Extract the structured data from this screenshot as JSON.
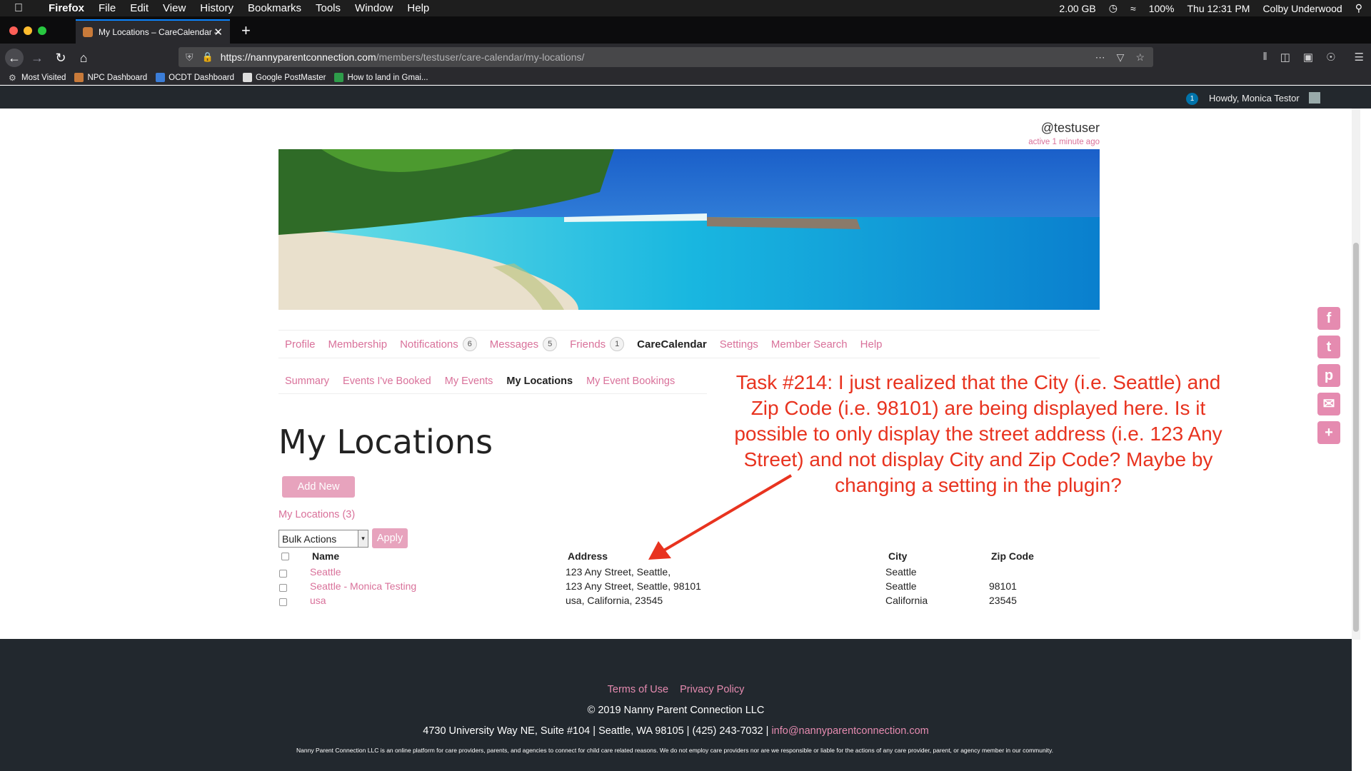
{
  "menubar": {
    "app": "Firefox",
    "items": [
      "File",
      "Edit",
      "View",
      "History",
      "Bookmarks",
      "Tools",
      "Window",
      "Help"
    ],
    "memory": "2.00 GB",
    "battery": "100%",
    "clock": "Thu 12:31 PM",
    "user": "Colby Underwood"
  },
  "browser": {
    "tab_title": "My Locations – CareCalendar –",
    "url_domain": "https://nannyparentconnection.com",
    "url_path": "/members/testuser/care-calendar/my-locations/",
    "bookmarks": [
      "Most Visited",
      "NPC Dashboard",
      "OCDT Dashboard",
      "Google PostMaster",
      "How to land in Gmai..."
    ]
  },
  "adminbar": {
    "notification_count": "1",
    "howdy": "Howdy, Monica Testor"
  },
  "profile": {
    "username": "@testuser",
    "activity": "active 1 minute ago"
  },
  "main_nav": [
    {
      "label": "Profile",
      "badge": ""
    },
    {
      "label": "Membership",
      "badge": ""
    },
    {
      "label": "Notifications",
      "badge": "6"
    },
    {
      "label": "Messages",
      "badge": "5"
    },
    {
      "label": "Friends",
      "badge": "1"
    },
    {
      "label": "CareCalendar",
      "badge": ""
    },
    {
      "label": "Settings",
      "badge": ""
    },
    {
      "label": "Member Search",
      "badge": ""
    },
    {
      "label": "Help",
      "badge": ""
    }
  ],
  "sub_nav": [
    "Summary",
    "Events I've Booked",
    "My Events",
    "My Locations",
    "My Event Bookings"
  ],
  "page": {
    "title": "My Locations",
    "add_new": "Add New",
    "count_label": "My Locations (3)",
    "bulk_actions": "Bulk Actions",
    "apply": "Apply"
  },
  "table": {
    "headers": {
      "name": "Name",
      "address": "Address",
      "city": "City",
      "zip": "Zip Code"
    },
    "rows": [
      {
        "name": "Seattle",
        "address": "123 Any Street, Seattle,",
        "city": "Seattle",
        "zip": ""
      },
      {
        "name": "Seattle - Monica Testing",
        "address": "123 Any Street, Seattle, 98101",
        "city": "Seattle",
        "zip": "98101"
      },
      {
        "name": "usa",
        "address": "usa, California, 23545",
        "city": "California",
        "zip": "23545"
      }
    ]
  },
  "annotation": {
    "lines": [
      "Task #214: I just realized that the City (i.e. Seattle) and",
      "Zip Code (i.e. 98101) are being displayed here. Is it",
      "possible to only display the street address (i.e. 123 Any",
      "Street) and not display City and Zip Code? Maybe by",
      "changing a setting in the plugin?"
    ],
    "color": "#e8331f"
  },
  "share_icons": [
    "facebook-icon",
    "twitter-icon",
    "pinterest-icon",
    "email-icon",
    "plus-icon"
  ],
  "footer": {
    "terms": "Terms of Use",
    "privacy": "Privacy Policy",
    "copyright": "© 2019 Nanny Parent Connection LLC",
    "address": "4730 University Way NE, Suite #104 | Seattle, WA 98105 | (425) 243-7032  |",
    "email": "info@nannyparentconnection.com",
    "disclaimer": "Nanny Parent Connection LLC is an online platform for care providers, parents, and agencies to connect for child care related reasons. We do not employ care providers nor are we responsible or liable for the actions of any care provider, parent, or agency member in our community."
  },
  "colors": {
    "accent_pink": "#d9719a",
    "button_pink": "#e7a3bd",
    "footer_bg": "#22282e",
    "admin_bar": "#23282d"
  }
}
